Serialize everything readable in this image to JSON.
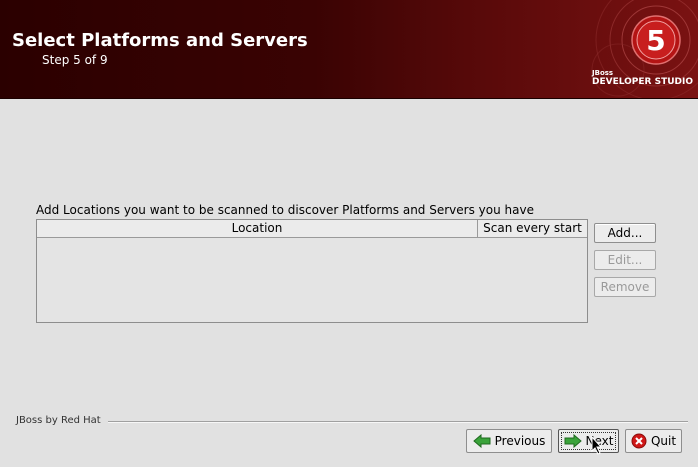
{
  "header": {
    "title": "Select Platforms and Servers",
    "step": "Step 5 of 9",
    "brand_small": "JBoss",
    "brand_big": "DEVELOPER STUDIO",
    "logo_glyph": "5"
  },
  "main": {
    "instruction": "Add Locations you want to be scanned to discover Platforms and Servers you have",
    "table": {
      "columns": [
        "Location",
        "Scan every start"
      ],
      "rows": []
    },
    "buttons": {
      "add": "Add...",
      "edit": "Edit...",
      "remove": "Remove"
    }
  },
  "footer": {
    "label": "JBoss by Red Hat",
    "previous": "Previous",
    "next": "Next",
    "quit": "Quit"
  },
  "colors": {
    "header_bg": "#3a0303",
    "accent_red": "#c81414",
    "next_arrow": "#2e8b2e",
    "quit_icon": "#d01818"
  },
  "icons": {
    "previous": "arrow-left-icon",
    "next": "arrow-right-icon",
    "quit": "close-circle-icon"
  }
}
